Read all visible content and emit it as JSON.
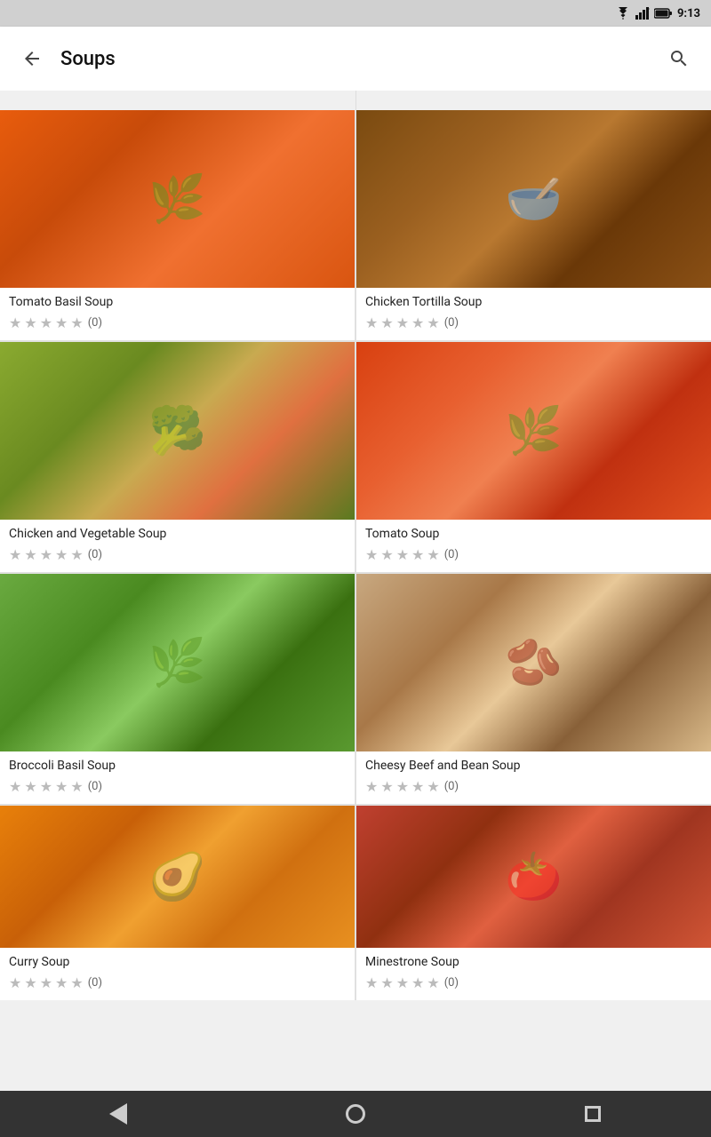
{
  "statusBar": {
    "time": "9:13",
    "wifiIcon": "wifi",
    "signalIcon": "signal",
    "batteryIcon": "battery"
  },
  "appBar": {
    "title": "Soups",
    "backLabel": "back",
    "searchLabel": "search"
  },
  "soups": [
    {
      "id": "tomato-basil",
      "name": "Tomato Basil Soup",
      "rating": "(0)",
      "imgClass": "img-tomato-basil",
      "emoji": "🌿"
    },
    {
      "id": "chicken-tortilla",
      "name": "Chicken Tortilla Soup",
      "rating": "(0)",
      "imgClass": "img-chicken-tortilla",
      "emoji": "🥣"
    },
    {
      "id": "chicken-veg",
      "name": "Chicken and Vegetable Soup",
      "rating": "(0)",
      "imgClass": "img-chicken-veg",
      "emoji": "🥦"
    },
    {
      "id": "tomato",
      "name": "Tomato Soup",
      "rating": "(0)",
      "imgClass": "img-tomato",
      "emoji": "🌿"
    },
    {
      "id": "broccoli-basil",
      "name": "Broccoli Basil Soup",
      "rating": "(0)",
      "imgClass": "img-broccoli",
      "emoji": "🌿"
    },
    {
      "id": "cheesy-beef",
      "name": "Cheesy Beef and Bean Soup",
      "rating": "(0)",
      "imgClass": "img-cheesy-beef",
      "emoji": "🫘"
    },
    {
      "id": "curry",
      "name": "Curry Soup",
      "rating": "(0)",
      "imgClass": "img-curry",
      "emoji": "🥑"
    },
    {
      "id": "minestrone",
      "name": "Minestrone Soup",
      "rating": "(0)",
      "imgClass": "img-minestrone",
      "emoji": "🍅"
    }
  ],
  "stars": [
    "★",
    "★",
    "★",
    "★",
    "★"
  ],
  "nav": {
    "backShape": "triangle",
    "homeShape": "circle",
    "menuShape": "square"
  }
}
